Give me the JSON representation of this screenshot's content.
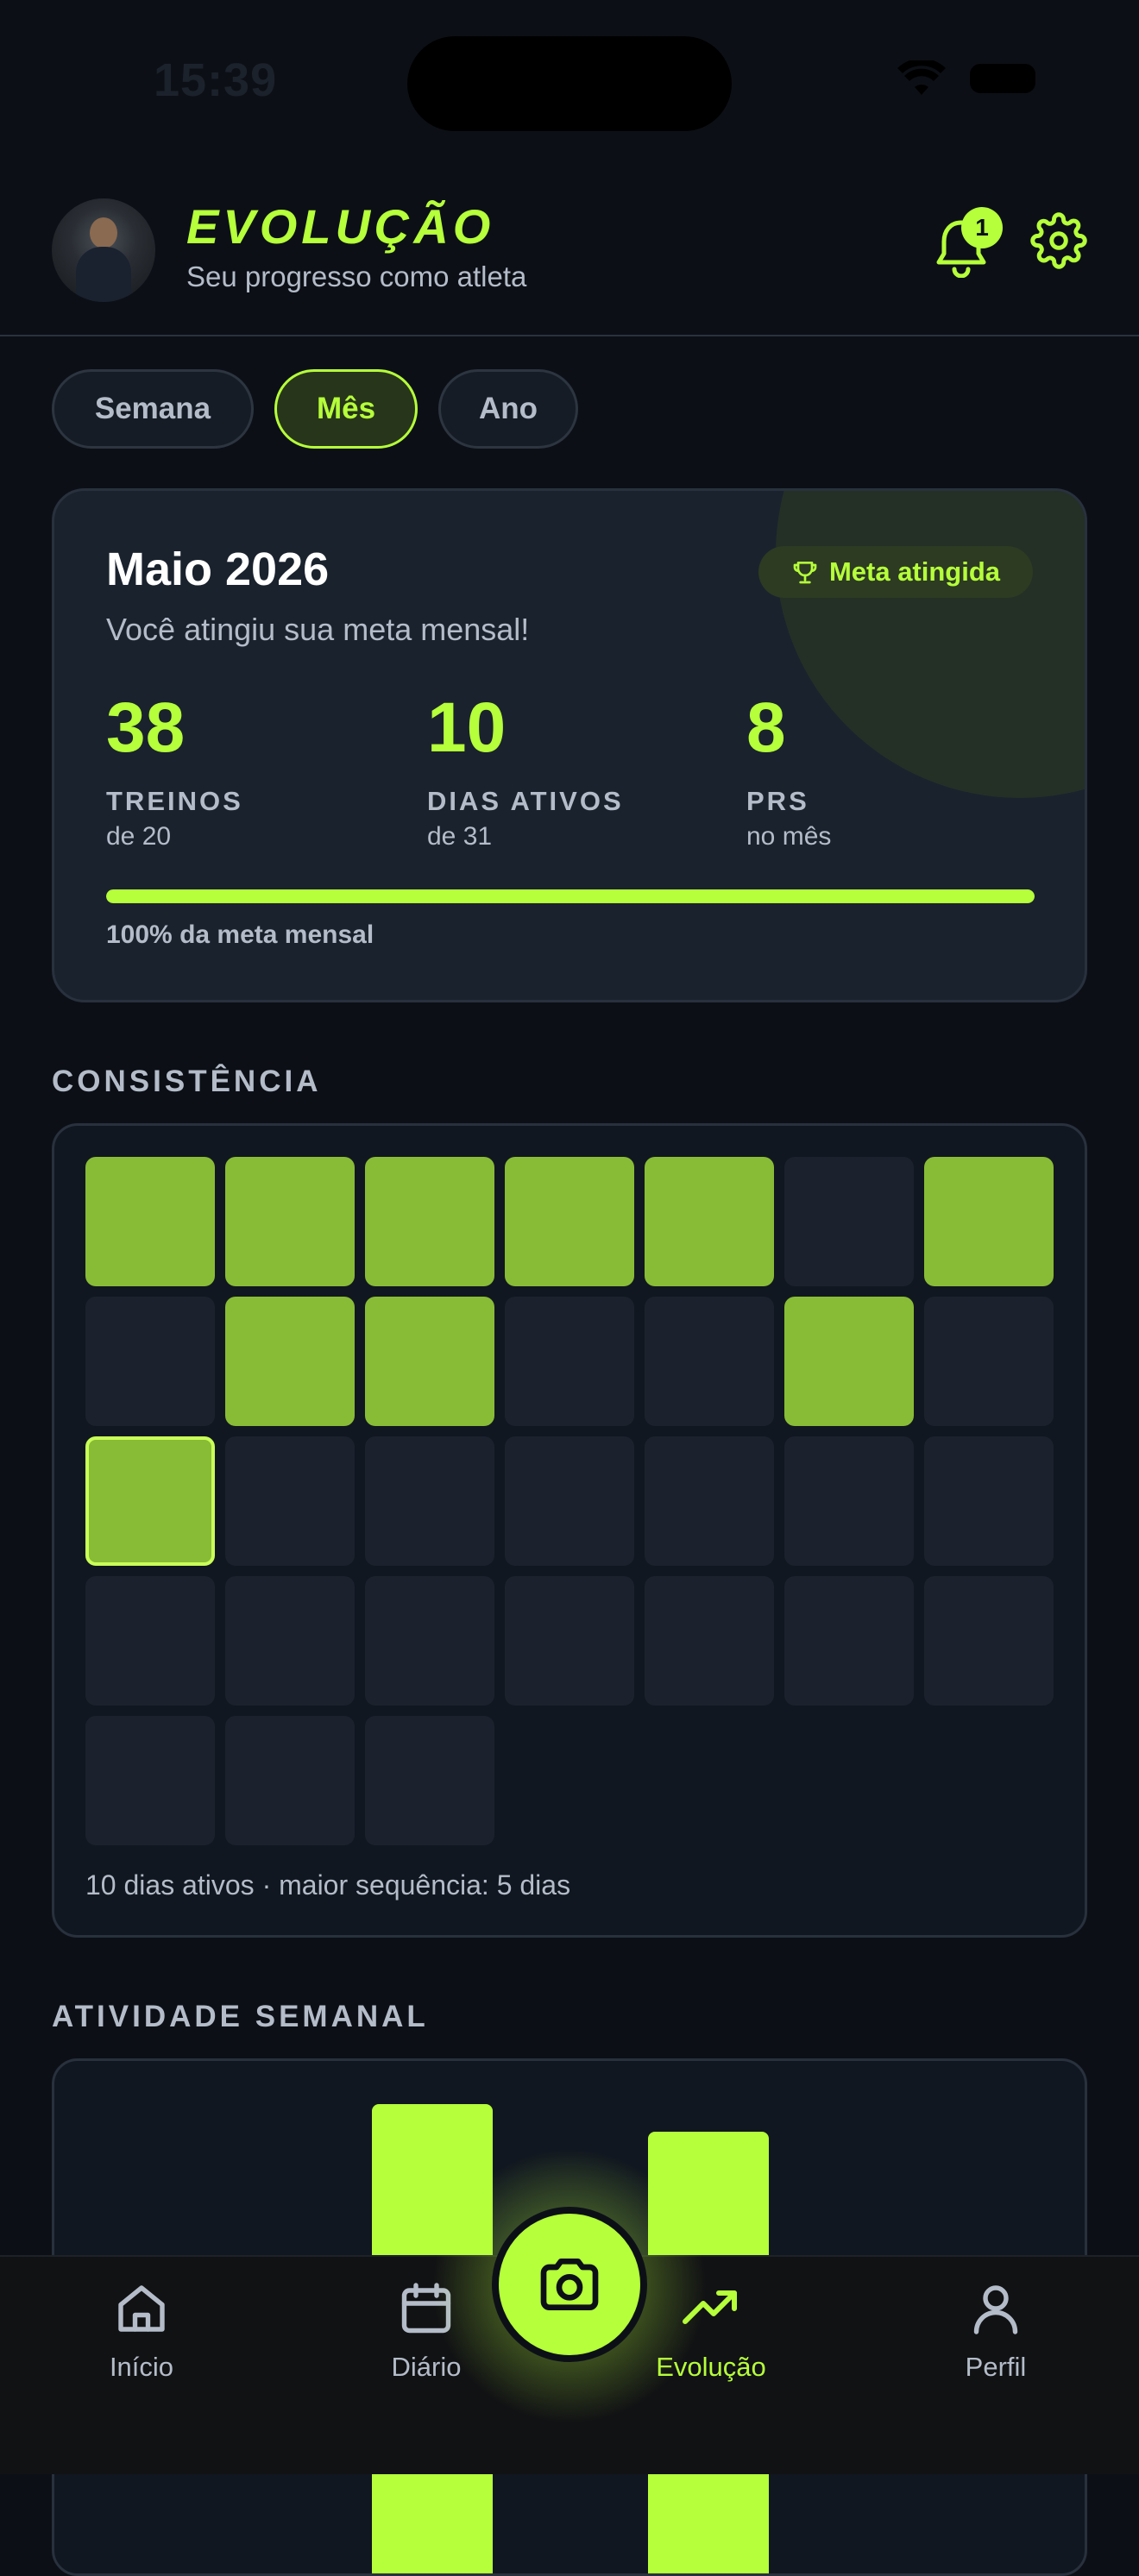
{
  "status_bar": {
    "time": "15:39"
  },
  "header": {
    "title": "EVOLUÇÃO",
    "subtitle": "Seu progresso como atleta",
    "notification_count": "1"
  },
  "period_tabs": [
    {
      "label": "Semana",
      "active": false
    },
    {
      "label": "Mês",
      "active": true
    },
    {
      "label": "Ano",
      "active": false
    }
  ],
  "summary": {
    "title": "Maio 2026",
    "message": "Você atingiu sua meta mensal!",
    "badge": "Meta atingida",
    "stats": [
      {
        "value": "38",
        "label": "TREINOS",
        "sub": "de 20"
      },
      {
        "value": "10",
        "label": "DIAS ATIVOS",
        "sub": "de 31"
      },
      {
        "value": "8",
        "label": "PRS",
        "sub": "no mês"
      }
    ],
    "progress_fraction": 1.0,
    "progress_label": "100% da meta mensal"
  },
  "consistency": {
    "section_title": "CONSISTÊNCIA",
    "days": [
      {
        "active": true
      },
      {
        "active": true
      },
      {
        "active": true
      },
      {
        "active": true
      },
      {
        "active": true
      },
      {
        "active": false
      },
      {
        "active": true
      },
      {
        "active": false
      },
      {
        "active": true
      },
      {
        "active": true
      },
      {
        "active": false
      },
      {
        "active": false
      },
      {
        "active": true
      },
      {
        "active": false
      },
      {
        "active": true,
        "today": true
      },
      {
        "active": false
      },
      {
        "active": false
      },
      {
        "active": false
      },
      {
        "active": false
      },
      {
        "active": false
      },
      {
        "active": false
      },
      {
        "active": false
      },
      {
        "active": false
      },
      {
        "active": false
      },
      {
        "active": false
      },
      {
        "active": false
      },
      {
        "active": false
      },
      {
        "active": false
      },
      {
        "active": false
      },
      {
        "active": false
      },
      {
        "active": false
      }
    ],
    "caption": "10 dias ativos · maior sequência: 5 dias"
  },
  "weekly": {
    "section_title": "ATIVIDADE SEMANAL"
  },
  "bottom_nav": [
    {
      "label": "Início",
      "icon": "home-icon",
      "active": false
    },
    {
      "label": "Diário",
      "icon": "calendar-icon",
      "active": false
    },
    {
      "label": "Evolução",
      "icon": "trending-up-icon",
      "active": true
    },
    {
      "label": "Perfil",
      "icon": "user-icon",
      "active": false
    }
  ],
  "colors": {
    "accent": "#b6ff3b",
    "background": "#0c1016",
    "card": "#1a222e",
    "active_day": "#88bc36",
    "inactive_day": "#1c222d"
  }
}
